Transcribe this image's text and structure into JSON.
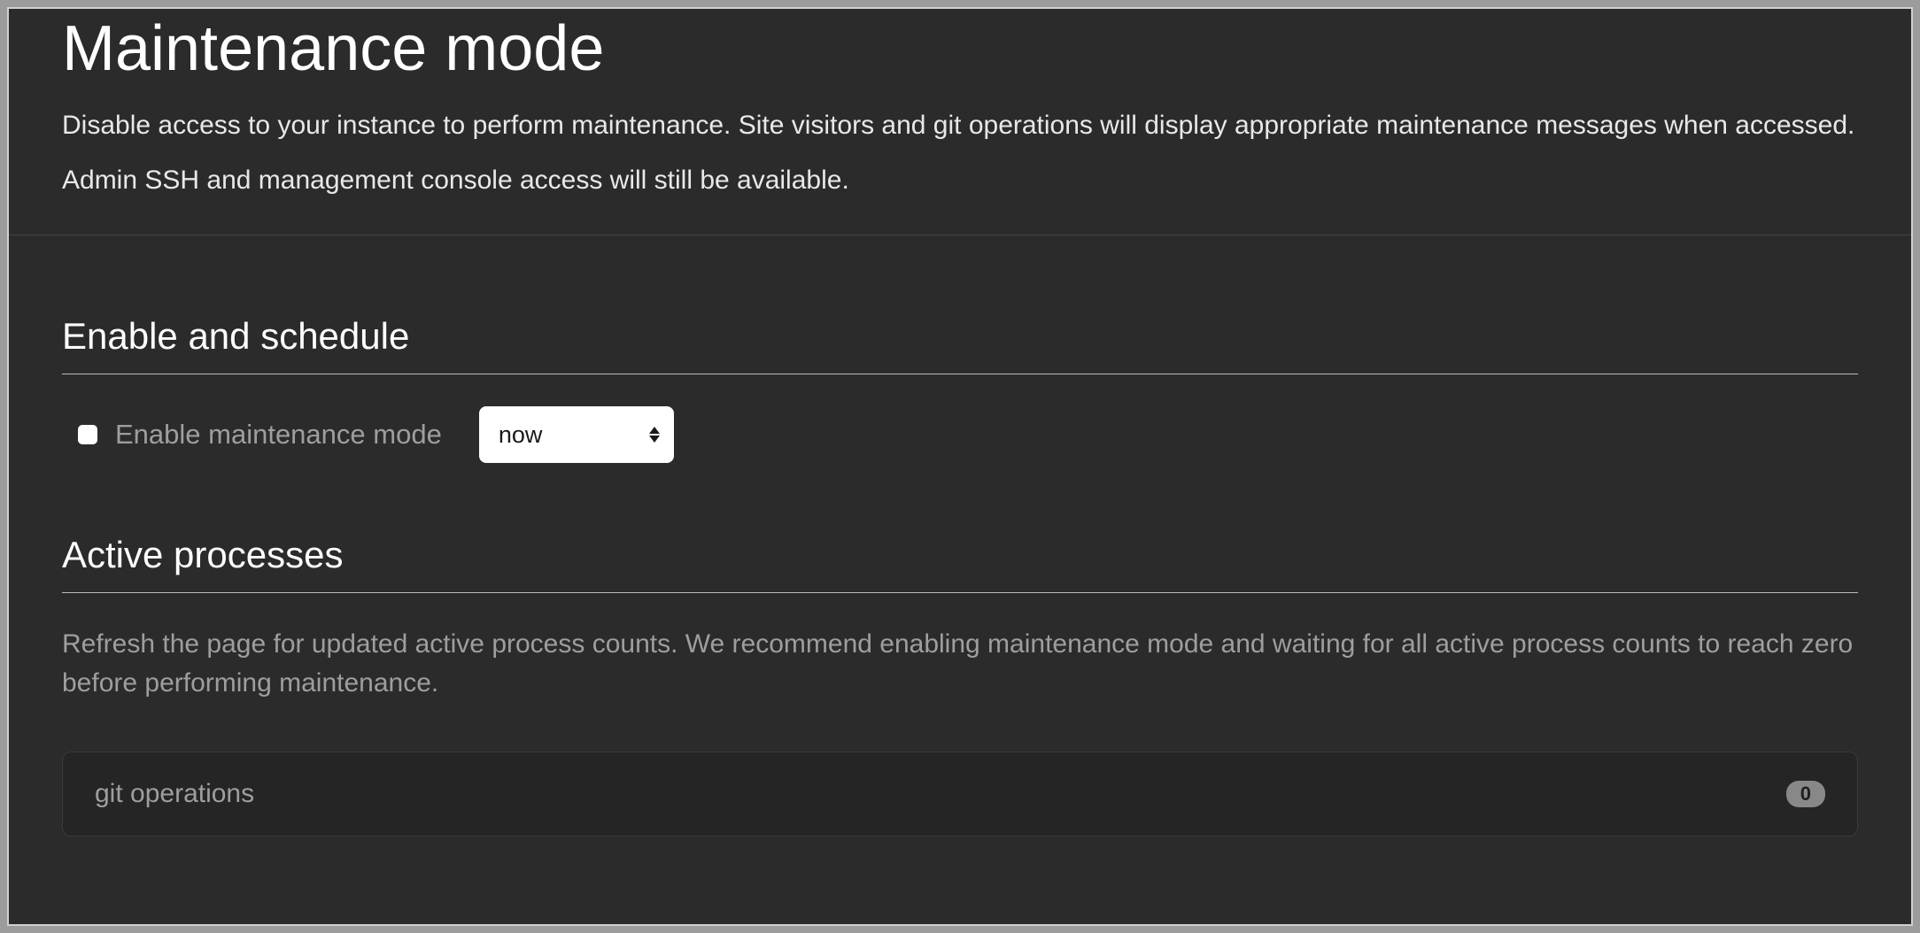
{
  "header": {
    "title": "Maintenance mode",
    "description1": "Disable access to your instance to perform maintenance. Site visitors and git operations will display appropriate maintenance messages when accessed.",
    "description2": "Admin SSH and management console access will still be available."
  },
  "enable_section": {
    "heading": "Enable and schedule",
    "checkbox_label": "Enable maintenance mode",
    "schedule_selected": "now"
  },
  "active_section": {
    "heading": "Active processes",
    "description": "Refresh the page for updated active process counts. We recommend enabling maintenance mode and waiting for all active process counts to reach zero before performing maintenance.",
    "processes": [
      {
        "name": "git operations",
        "count": "0"
      }
    ]
  }
}
